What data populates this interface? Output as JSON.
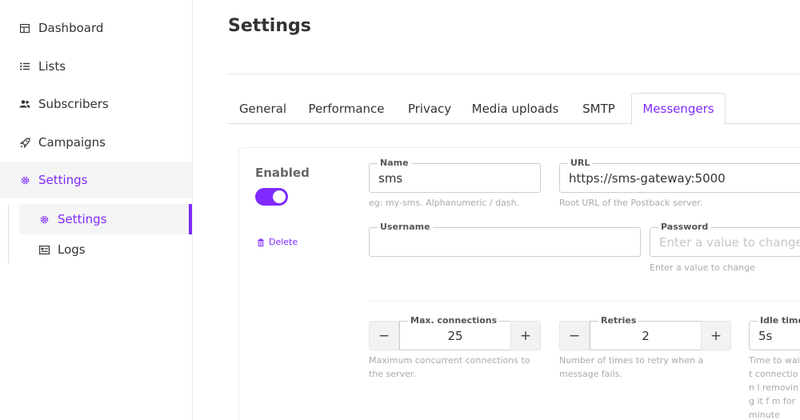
{
  "sidebar": {
    "items": [
      {
        "label": "Dashboard",
        "icon": "dashboard-icon"
      },
      {
        "label": "Lists",
        "icon": "list-icon"
      },
      {
        "label": "Subscribers",
        "icon": "users-icon"
      },
      {
        "label": "Campaigns",
        "icon": "rocket-icon"
      },
      {
        "label": "Settings",
        "icon": "gear-icon"
      }
    ],
    "subitems": [
      {
        "label": "Settings",
        "icon": "gear-icon"
      },
      {
        "label": "Logs",
        "icon": "log-icon"
      }
    ]
  },
  "page": {
    "title": "Settings"
  },
  "tabs": [
    "General",
    "Performance",
    "Privacy",
    "Media uploads",
    "SMTP",
    "Messengers"
  ],
  "messenger": {
    "enabled_label": "Enabled",
    "enabled": true,
    "delete_label": "Delete",
    "name": {
      "label": "Name",
      "value": "sms",
      "help": "eg: my-sms. Alphanumeric / dash."
    },
    "url": {
      "label": "URL",
      "value": "https://sms-gateway:5000",
      "help": "Root URL of the Postback server."
    },
    "username": {
      "label": "Username",
      "value": ""
    },
    "password": {
      "label": "Password",
      "placeholder": "Enter a value to change",
      "help": "Enter a value to change"
    },
    "max_connections": {
      "label": "Max. connections",
      "value": "25",
      "help": "Maximum concurrent connections to the server."
    },
    "retries": {
      "label": "Retries",
      "value": "2",
      "help": "Number of times to retry when a message fails."
    },
    "idle_timeout": {
      "label": "Idle timed",
      "value": "5s",
      "help": "Time to wait connection l removing it f m for minute"
    },
    "minus": "−",
    "plus": "+"
  },
  "colors": {
    "accent": "#7f2aff"
  }
}
